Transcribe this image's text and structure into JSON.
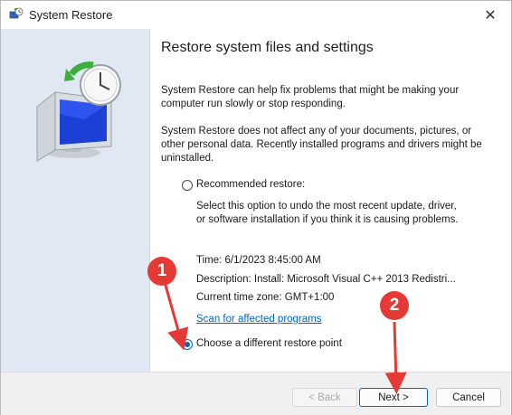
{
  "window": {
    "title": "System Restore",
    "close_glyph": "✕"
  },
  "content": {
    "heading": "Restore system files and settings",
    "para1": "System Restore can help fix problems that might be making your computer run slowly or stop responding.",
    "para2": "System Restore does not affect any of your documents, pictures, or other personal data. Recently installed programs and drivers might be uninstalled.",
    "recommended_label": "Recommended restore:",
    "recommended_desc": "Select this option to undo the most recent update, driver, or software installation if you think it is causing problems.",
    "time": "Time: 6/1/2023 8:45:00 AM",
    "description": "Description: Install: Microsoft Visual C++ 2013 Redistri...",
    "timezone": "Current time zone: GMT+1:00",
    "scan_link": "Scan for affected programs",
    "different_label": "Choose a different restore point"
  },
  "footer": {
    "back_label": "< Back",
    "next_label": "Next >",
    "cancel_label": "Cancel"
  },
  "annotations": {
    "one": "1",
    "two": "2"
  },
  "colors": {
    "accent": "#0067c0",
    "annotation": "#e53935",
    "panel": "#dfe8f3"
  },
  "icons": {
    "title": "system-restore-icon",
    "art": "monitor-clock-restore-icon"
  }
}
